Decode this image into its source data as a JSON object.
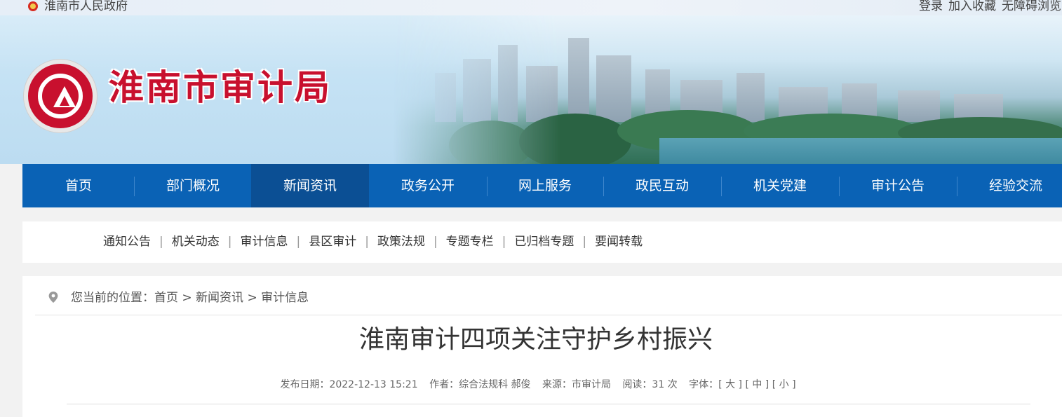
{
  "topbar": {
    "gov_name": "淮南市人民政府",
    "links": [
      "登录",
      "加入收藏",
      "无障碍浏览"
    ]
  },
  "header": {
    "site_title": "淮南市审计局",
    "brand_color": "#c8102e"
  },
  "nav": {
    "items": [
      "首页",
      "部门概况",
      "新闻资讯",
      "政务公开",
      "网上服务",
      "政民互动",
      "机关党建",
      "审计公告",
      "经验交流"
    ],
    "active_index": 2,
    "bg_color": "#0a62b5",
    "active_color": "#0b4f94"
  },
  "subnav": {
    "items": [
      "通知公告",
      "机关动态",
      "审计信息",
      "县区审计",
      "政策法规",
      "专题专栏",
      "已归档专题",
      "要闻转载"
    ]
  },
  "breadcrumb": {
    "prefix": "您当前的位置：",
    "items": [
      "首页",
      "新闻资讯",
      "审计信息"
    ],
    "separator": " > "
  },
  "article": {
    "title": "淮南审计四项关注守护乡村振兴",
    "publish_date": "发布日期：2022-12-13 15:21",
    "author": "作者：综合法规科 郝俊",
    "source": "来源：市审计局",
    "reads": "阅读：31 次",
    "font_label": "字体：",
    "font_sizes": [
      "[ 大 ]",
      "[ 中 ]",
      "[ 小 ]"
    ]
  }
}
